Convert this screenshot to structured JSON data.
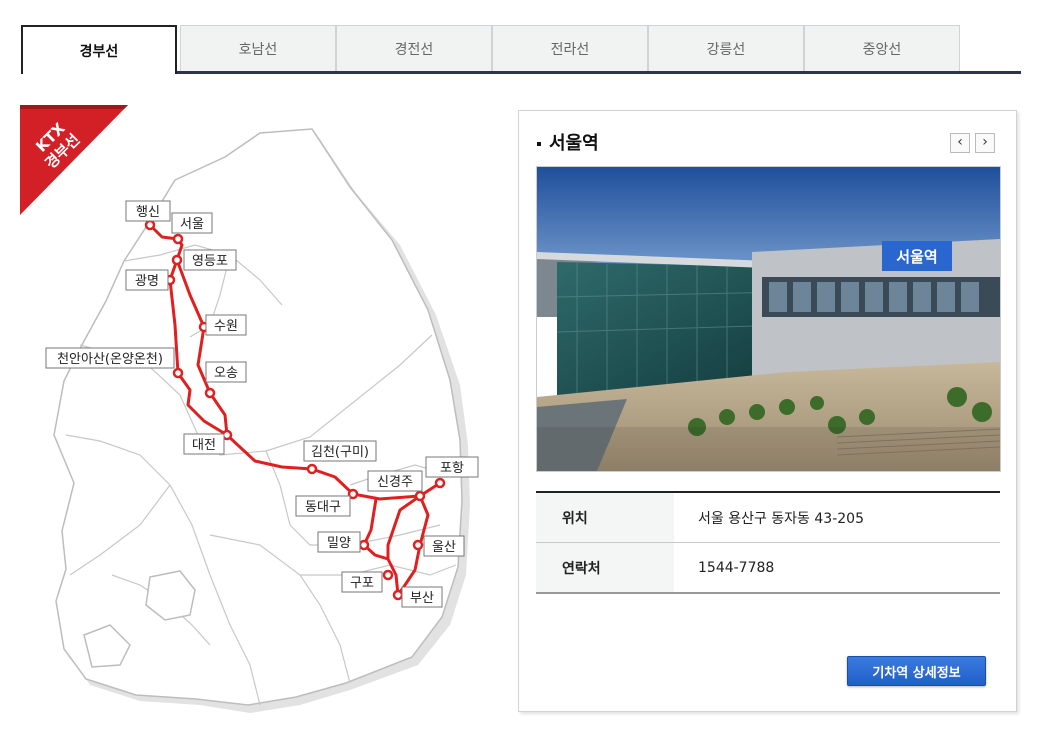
{
  "tabs": [
    {
      "label": "경부선",
      "active": true
    },
    {
      "label": "호남선",
      "active": false
    },
    {
      "label": "경전선",
      "active": false
    },
    {
      "label": "전라선",
      "active": false
    },
    {
      "label": "강릉선",
      "active": false
    },
    {
      "label": "중앙선",
      "active": false
    }
  ],
  "map": {
    "ribbon_line1": "KTX",
    "ribbon_line2": "경부선",
    "line_color": "#e02020",
    "ribbon_color": "#d32027",
    "stations": {
      "haengsin": "행신",
      "seoul": "서울",
      "yeongdeungpo": "영등포",
      "gwangmyeong": "광명",
      "suwon": "수원",
      "cheonan": "천안아산(온양온천)",
      "osong": "오송",
      "daejeon": "대전",
      "gimcheon": "김천(구미)",
      "singyeongju": "신경주",
      "pohang": "포항",
      "dongdaegu": "동대구",
      "miryang": "밀양",
      "ulsan": "울산",
      "gupo": "구포",
      "busan": "부산"
    }
  },
  "panel": {
    "title": "서울역",
    "prev_icon": "‹",
    "next_icon": "›",
    "rows": [
      {
        "key": "위치",
        "value": "서울 용산구 동자동 43-205"
      },
      {
        "key": "연락처",
        "value": "1544-7788"
      }
    ],
    "detail_button": "기차역 상세정보",
    "photo_sign": "서울역",
    "accent_color": "#2a66d0"
  }
}
